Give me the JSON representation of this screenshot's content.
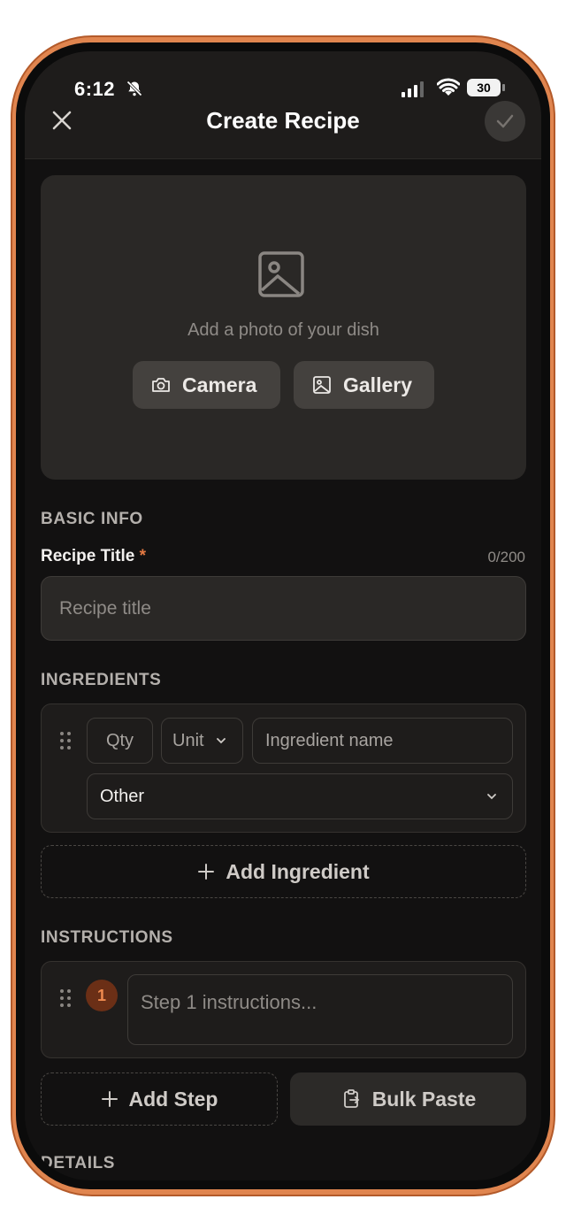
{
  "status_bar": {
    "time": "6:12",
    "battery": "30"
  },
  "header": {
    "title": "Create Recipe"
  },
  "photo": {
    "prompt": "Add a photo of your dish",
    "camera_label": "Camera",
    "gallery_label": "Gallery"
  },
  "basic_info": {
    "section_label": "BASIC INFO",
    "title_label": "Recipe Title",
    "required_mark": "*",
    "counter": "0/200",
    "title_placeholder": "Recipe title"
  },
  "ingredients": {
    "section_label": "INGREDIENTS",
    "qty_placeholder": "Qty",
    "unit_label": "Unit",
    "name_placeholder": "Ingredient name",
    "category_value": "Other",
    "add_label": "Add Ingredient"
  },
  "instructions": {
    "section_label": "INSTRUCTIONS",
    "step_number": "1",
    "step_placeholder": "Step 1 instructions...",
    "add_step_label": "Add Step",
    "bulk_paste_label": "Bulk Paste"
  },
  "details": {
    "section_label": "DETAILS"
  },
  "colors": {
    "accent": "#e57a43",
    "frame": "#e0854f",
    "background": "#121111"
  }
}
